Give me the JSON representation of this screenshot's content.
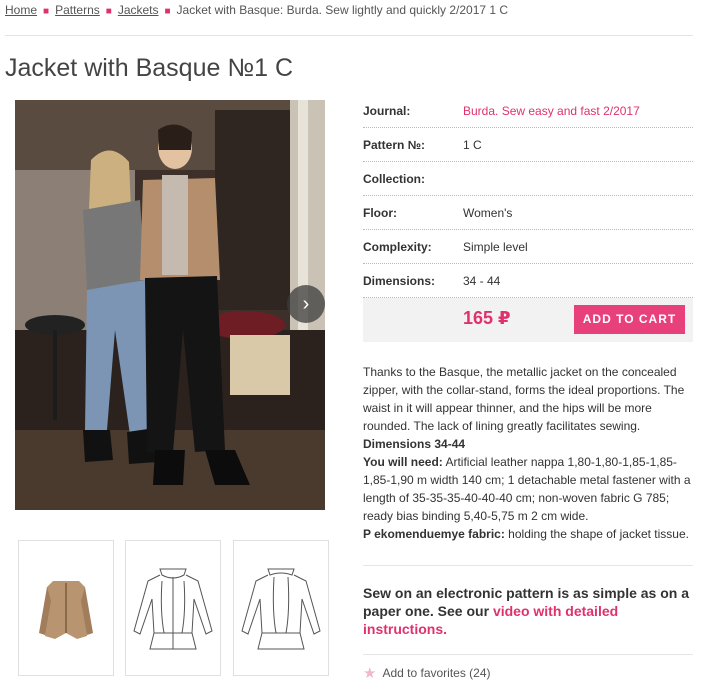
{
  "breadcrumb": {
    "home": "Home",
    "patterns": "Patterns",
    "jackets": "Jackets",
    "current": "Jacket with Basque: Burda. Sew lightly and quickly 2/2017 1 C"
  },
  "page_title": "Jacket with Basque №1 C",
  "specs": {
    "journal_label": "Journal:",
    "journal_value": "Burda. Sew easy and fast 2/2017",
    "pattern_label": "Pattern №:",
    "pattern_value": "1 C",
    "collection_label": "Collection:",
    "collection_value": "",
    "floor_label": "Floor:",
    "floor_value": "Women's",
    "complexity_label": "Complexity:",
    "complexity_value": "Simple level",
    "dimensions_label": "Dimensions:",
    "dimensions_value": "34 - 44"
  },
  "purchase": {
    "price": "165 ₽",
    "add_to_cart": "ADD TO CART"
  },
  "description": {
    "intro": "Thanks to the Basque, the metallic jacket on the concealed zipper, with the collar-stand, forms the ideal proportions. The waist in it will appear thinner, and the hips will be more rounded. The lack of lining greatly facilitates sewing.",
    "dimensions_heading": "Dimensions 34-44",
    "need_label": "You will need:",
    "need_text": " Artificial leather nappa 1,80-1,80-1,85-1,85-1,85-1,90 m width 140 cm; 1 detachable metal fastener with a length of 35-35-35-40-40-40 cm; non-woven fabric G 785; ready bias binding 5,40-5,75 m 2 cm wide.",
    "fabric_label": "P ekomenduemye fabric:",
    "fabric_text": " holding the shape of jacket tissue."
  },
  "promo": {
    "text": "Sew on an electronic pattern is as simple as on a paper one. See our ",
    "link": "video with detailed instructions."
  },
  "favorites": {
    "label": "Add to favorites (24)"
  },
  "colors": {
    "accent": "#e0316f",
    "button": "#e8407a",
    "price_bar": "#f2f2f2"
  },
  "icons": {
    "next": "chevron-right-icon",
    "favorite": "star-icon"
  }
}
